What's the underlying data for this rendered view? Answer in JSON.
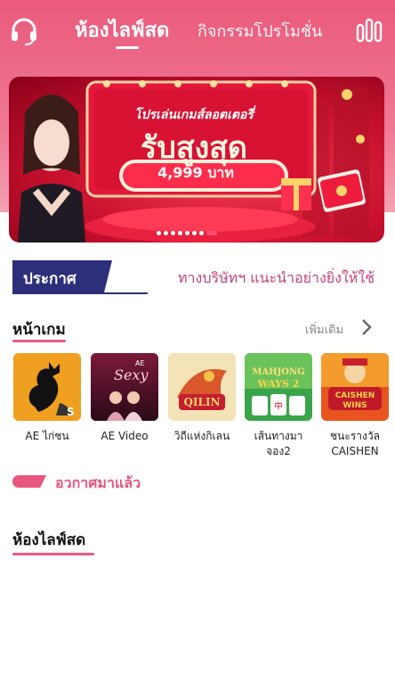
{
  "header": {
    "tab_live": "ห้องไลฟ์สด",
    "tab_promo": "กิจกรรมโปรโมชั่น",
    "accent": "#ea5a7d"
  },
  "banner": {
    "line1": "โปรเล่นเกมส์ลอตเตอรี่",
    "line2": "รับสูงสุด",
    "line3": "4,999 บาท",
    "dots_count": 8,
    "active_dot": 7
  },
  "announcement": {
    "tag": "ประกาศ",
    "text": "ทางบริษัทฯ แนะนำอย่างยิ่งให้ใช้"
  },
  "games": {
    "title": "หน้าเกม",
    "more": "เพิ่มเติม",
    "items": [
      {
        "name": "AE ไก่ชน",
        "icon": "rooster-icon"
      },
      {
        "name": "AE Video",
        "icon": "ae-sexy-icon"
      },
      {
        "name": "วิถีแห่งกิเลน",
        "icon": "ways-qilin-icon"
      },
      {
        "name": "เส้นทางมาจอง2",
        "icon": "mahjong-ways2-icon"
      },
      {
        "name": "ชนะรางวัล CAISHEN",
        "icon": "caishen-wins-icon"
      }
    ]
  },
  "expired": {
    "label": "อวกาศมาแล้ว"
  },
  "live": {
    "title": "ห้องไลฟ์สด"
  }
}
